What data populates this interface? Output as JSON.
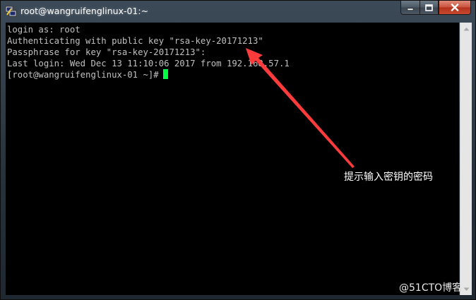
{
  "window": {
    "title": "root@wangruifenglinux-01:~",
    "controls": [
      "minimize",
      "maximize",
      "close"
    ]
  },
  "terminal": {
    "lines": [
      "login as: root",
      "Authenticating with public key \"rsa-key-20171213\"",
      "Passphrase for key \"rsa-key-20171213\":",
      "Last login: Wed Dec 13 11:10:06 2017 from 192.168.57.1",
      "[root@wangruifenglinux-01 ~]#"
    ],
    "cursor_color": "#00ff40"
  },
  "annotation": {
    "text": "提示输入密钥的密码",
    "arrow_color": "#ff3b3b"
  },
  "watermark": "@51CTO博客",
  "colors": {
    "terminal_bg": "#000000",
    "terminal_fg": "#c0c0c0",
    "close_button": "#c9513b"
  }
}
